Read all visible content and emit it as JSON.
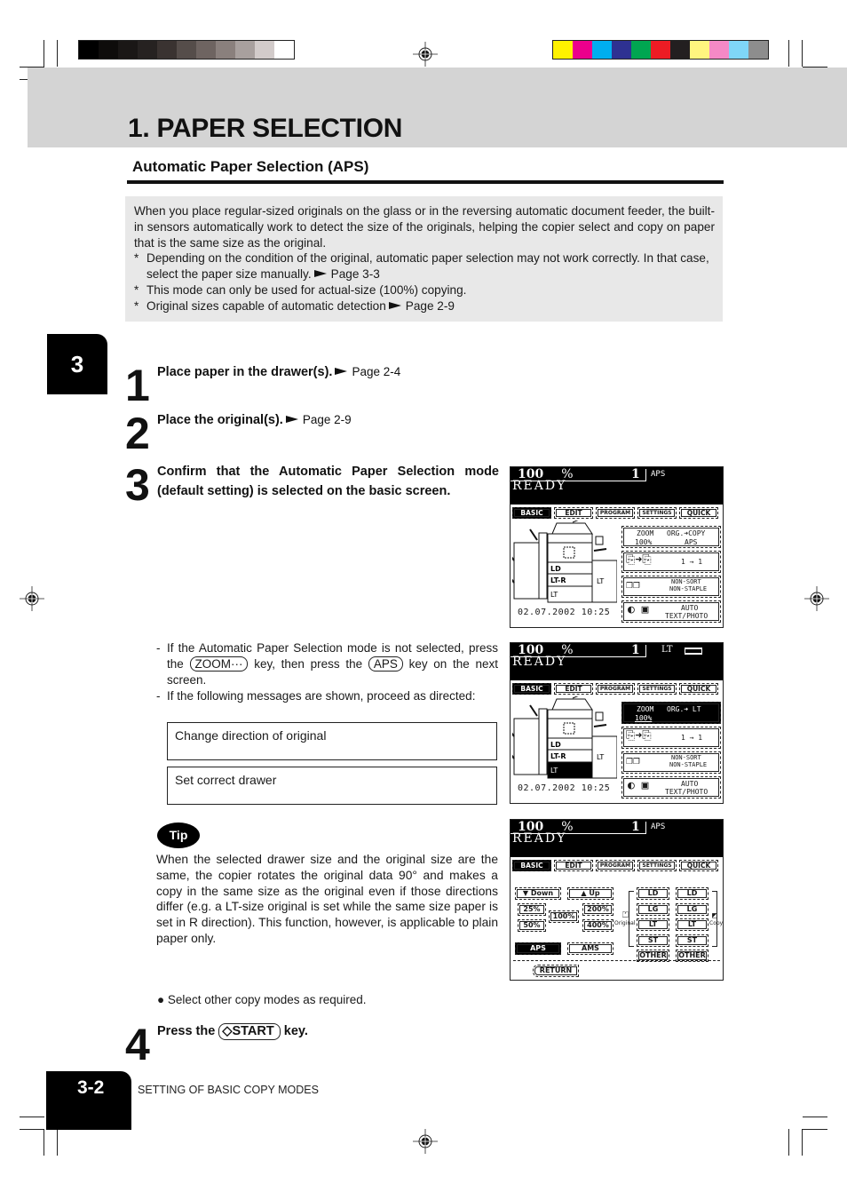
{
  "print_marks": {
    "grayscale_swatches": [
      "#000000",
      "#0e0c0b",
      "#1a1716",
      "#262221",
      "#3a3331",
      "#554d4a",
      "#6e6461",
      "#8a807d",
      "#a8a09e",
      "#d2cbca",
      "#ffffff"
    ],
    "color_swatches": [
      "#fff200",
      "#ec008c",
      "#00aeef",
      "#2e3192",
      "#00a651",
      "#ed1c24",
      "#231f20",
      "#fff57f",
      "#f589c6",
      "#7fd6f7",
      "#8d8d8d"
    ]
  },
  "header": {
    "page_title": "1. PAPER SELECTION",
    "section_title": "Automatic Paper Selection (APS)"
  },
  "intro": {
    "paragraph": "When you place regular-sized originals on the glass or in the reversing automatic document feeder, the built-in sensors automatically work to detect the size of the originals, helping the copier select and copy on paper that is the same size as the original.",
    "notes": [
      {
        "text": "Depending on the condition of the original, automatic paper selection may not work correctly. In that case, select the paper size manually.",
        "ref": "Page 3-3"
      },
      {
        "text": "This mode can only be used for actual-size (100%) copying.",
        "ref": ""
      },
      {
        "text": "Original sizes capable of automatic detection",
        "ref": "Page 2-9"
      }
    ],
    "star": "*"
  },
  "chapter_tab": "3",
  "steps": [
    {
      "num": "1",
      "text": "Place paper in the drawer(s).",
      "ref": "Page 2-4"
    },
    {
      "num": "2",
      "text": "Place the original(s).",
      "ref": "Page 2-9"
    },
    {
      "num": "3",
      "text": "Confirm that the Automatic Paper Selection mode (default setting) is selected on the basic screen."
    },
    {
      "num": "4",
      "text_before": "Press the",
      "key": "START",
      "text_after": "key."
    }
  ],
  "step3_notes": {
    "item1_a": "If the Automatic Paper Selection mode is not selected, press the",
    "zoom_key": "ZOOM···",
    "item1_b": "key, then press the",
    "aps_key": "APS",
    "item1_c": "key on the next screen.",
    "item2": "If the following messages are shown, proceed as directed:",
    "dash": "-"
  },
  "messages": [
    "Change direction of original",
    "Set correct drawer"
  ],
  "tip": {
    "label": "Tip",
    "text": "When the selected drawer size and the original size are the same, the copier rotates the original data 90° and makes a copy in the same size as the original even if those directions differ (e.g. a LT-size original is set while the same size paper is set in R direction).  This function, however, is applicable to plain paper only."
  },
  "bullet_note": "Select other copy modes as required.",
  "footer": {
    "page_number": "3-2",
    "chapter_name": "SETTING OF BASIC COPY MODES"
  },
  "screens": [
    {
      "zoom": "100",
      "percent": "%",
      "count": "1",
      "mode": "APS",
      "status": "READY",
      "tabs": [
        "BASIC",
        "EDIT",
        "PROGRAM",
        "SETTINGS",
        "QUICK"
      ],
      "active_tab": "BASIC",
      "drawers": [
        "LD",
        "LT-R",
        "LT"
      ],
      "lcf": "LT",
      "date": "02.07.2002 10:25",
      "buttons": {
        "zoom_label": "ZOOM",
        "zoom_value": "100%",
        "org_copy": "ORG.➜COPY",
        "paper": "APS",
        "finishing_ratio": "1 → 1",
        "sort_1": "NON-SORT",
        "sort_2": "NON-STAPLE",
        "mode_1": "AUTO",
        "mode_2": "TEXT/PHOTO"
      }
    },
    {
      "zoom": "100",
      "percent": "%",
      "count": "1",
      "mode": "LT",
      "status": "READY",
      "tabs": [
        "BASIC",
        "EDIT",
        "PROGRAM",
        "SETTINGS",
        "QUICK"
      ],
      "active_tab": "BASIC",
      "drawers": [
        "LD",
        "LT-R",
        "LT"
      ],
      "lcf": "LT",
      "selected_drawer": "LT",
      "date": "02.07.2002 10:25",
      "buttons": {
        "zoom_label": "ZOOM",
        "zoom_value": "100%",
        "org_copy": "ORG.➜ LT",
        "paper": "",
        "finishing_ratio": "1 → 1",
        "sort_1": "NON-SORT",
        "sort_2": "NON-STAPLE",
        "mode_1": "AUTO",
        "mode_2": "TEXT/PHOTO"
      }
    },
    {
      "zoom": "100",
      "percent": "%",
      "count": "1",
      "mode": "APS",
      "status": "READY",
      "tabs": [
        "BASIC",
        "EDIT",
        "PROGRAM",
        "SETTINGS",
        "QUICK"
      ],
      "active_tab": "BASIC",
      "zoom_buttons": {
        "down": "▼ Down",
        "up": "▲ Up",
        "p25": "25%",
        "p50": "50%",
        "p100": "100%",
        "p200": "200%",
        "p400": "400%",
        "aps": "APS",
        "ams": "AMS"
      },
      "original_sizes": [
        "LD",
        "LG",
        "LT",
        "ST",
        "OTHER"
      ],
      "copy_sizes": [
        "LD",
        "LG",
        "LT",
        "ST",
        "OTHER"
      ],
      "original_label": "Original",
      "copy_label": "Copy",
      "return_label": "RETURN"
    }
  ]
}
